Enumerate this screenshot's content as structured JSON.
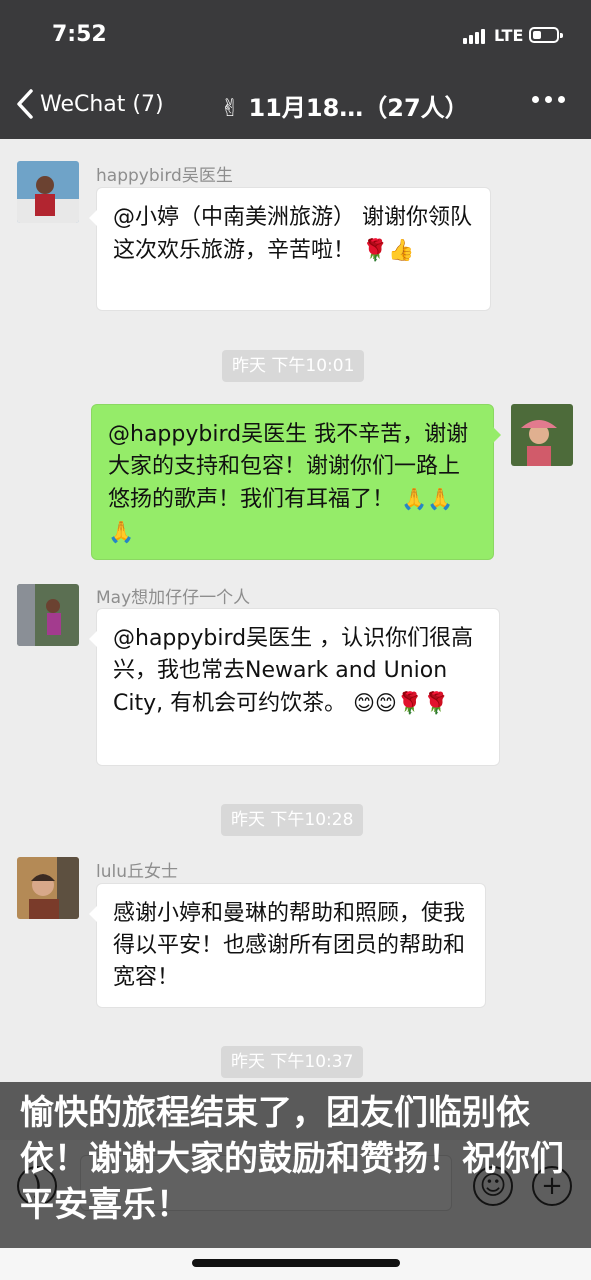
{
  "status": {
    "time": "7:52",
    "network": "LTE"
  },
  "nav": {
    "back_label": "WeChat (7)",
    "title_emoji": "✌",
    "title": "11月18…（27人）"
  },
  "messages": [
    {
      "sender": "happybird吴医生",
      "text": "@小婷（中南美洲旅游） 谢谢你领队这次欢乐旅游，辛苦啦！",
      "emoji": "🌹👍"
    },
    {
      "timestamp": "昨天 下午10:01"
    },
    {
      "sender": "me",
      "text": "@happybird吴医生 我不辛苦，谢谢大家的支持和包容！谢谢你们一路上悠扬的歌声！我们有耳福了！",
      "emoji": "🙏🙏🙏"
    },
    {
      "sender": "May想加仔仔一个人",
      "text": "@happybird吴医生 ，认识你们很高兴，我也常去Newark and Union City, 有机会可约饮茶。",
      "emoji": "😊😊🌹🌹"
    },
    {
      "timestamp": "昨天 下午10:28"
    },
    {
      "sender": "lulu丘女士",
      "text": "感谢小婷和曼琳的帮助和照顾，使我得以平安！也感谢所有团员的帮助和宽容！"
    },
    {
      "timestamp": "昨天 下午10:37"
    }
  ],
  "caption": "愉快的旅程结束了，团友们临别依依！谢谢大家的鼓励和赞扬！祝你们平安喜乐！",
  "icons": {
    "voice": "voice-icon",
    "emoji": "emoji-icon",
    "plus": "plus-icon"
  },
  "colors": {
    "bar": "#3a3a3c",
    "chat_bg": "#ededed",
    "self_bubble": "#95ec69"
  }
}
